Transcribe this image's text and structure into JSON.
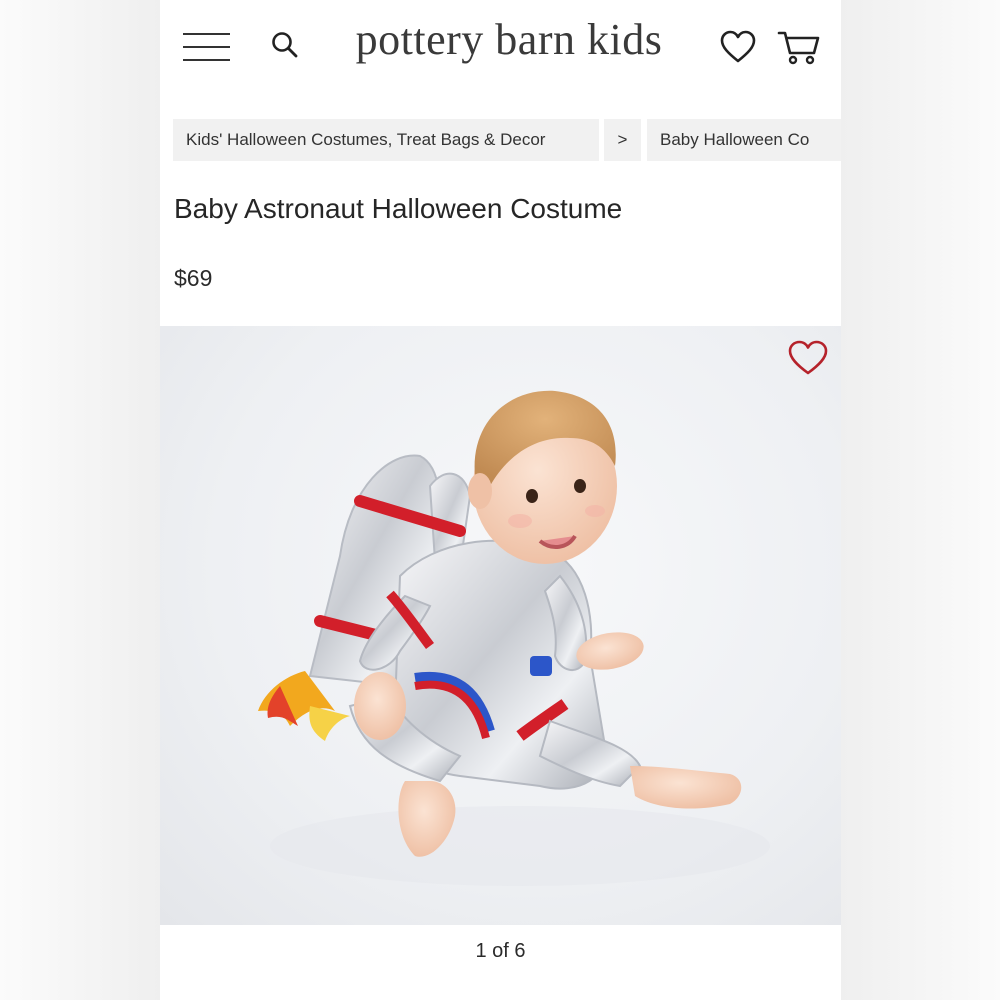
{
  "header": {
    "logo": "pottery barn kids",
    "icons": [
      "menu-icon",
      "search-icon",
      "heart-icon",
      "cart-icon"
    ]
  },
  "breadcrumb": {
    "items": [
      "Kids' Halloween Costumes, Treat Bags & Decor",
      "Baby Halloween Co"
    ],
    "separator": ">"
  },
  "product": {
    "title": "Baby Astronaut Halloween Costume",
    "price": "$69",
    "image_alt": "Baby wearing silver astronaut costume with rocket backpack",
    "favorite_color": "#b5222b"
  },
  "gallery": {
    "pager": "1 of 6"
  }
}
